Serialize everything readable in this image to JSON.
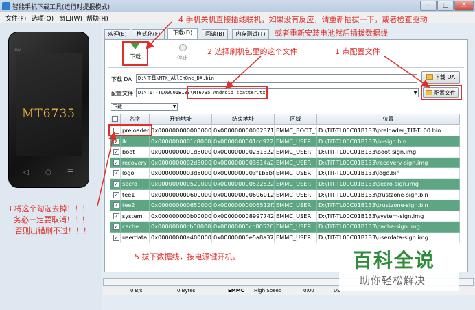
{
  "window": {
    "title": "智能手机下载工具(运行时提报模式)"
  },
  "winbuttons": {
    "min": "–",
    "max": "□",
    "close": "X"
  },
  "menu": [
    {
      "label": "文件(F)"
    },
    {
      "label": "选项(O)"
    },
    {
      "label": "窗口(W)"
    },
    {
      "label": "帮助(H)"
    }
  ],
  "phone": {
    "model": "MT6735",
    "brand": "IBM"
  },
  "tabs": [
    {
      "label": "欢迎(E)"
    },
    {
      "label": "格式化(F)"
    },
    {
      "label": "下载(D)"
    },
    {
      "label": "回读(B)"
    },
    {
      "label": "内存测试(T)"
    }
  ],
  "toolbar": {
    "download_label": "下载",
    "stop_label": "停止"
  },
  "fields": {
    "da_label": "下载 DA",
    "da_value": "D:\\工具\\MTK_AllInOne_DA.bin",
    "da_button": "下载 DA",
    "scatter_label": "配置文件",
    "scatter_value": "D:\\TIT-TL00C01B133\\MT6735_Android_scatter.txt",
    "scatter_button": "配置文件",
    "mode_value": "下载"
  },
  "table": {
    "headers": [
      "名字",
      "开始地址",
      "结束地址",
      "区域",
      "位置"
    ],
    "rows": [
      {
        "checked": false,
        "selected": false,
        "name": "preloader",
        "start": "0x0000000000000000",
        "end": "0x000000000002371f",
        "region": "EMMC_BOOT_1",
        "path": "D:\\TIT-TL00C01B133\\preloader_TIT-TL00.bin"
      },
      {
        "checked": true,
        "selected": true,
        "name": "lk",
        "start": "0x0000000001c80000",
        "end": "0x0000000001cd922b",
        "region": "EMMC_USER",
        "path": "D:\\TIT-TL00C01B133\\lk-sign.bin"
      },
      {
        "checked": true,
        "selected": false,
        "name": "boot",
        "start": "0x0000000001d80000",
        "end": "0x000000000251322b",
        "region": "EMMC_USER",
        "path": "D:\\TIT-TL00C01B133\\boot-sign.img"
      },
      {
        "checked": true,
        "selected": true,
        "name": "recovery",
        "start": "0x0000000002d80000",
        "end": "0x0000000003614a2b",
        "region": "EMMC_USER",
        "path": "D:\\TIT-TL00C01B133\\recovery-sign.img"
      },
      {
        "checked": true,
        "selected": false,
        "name": "logo",
        "start": "0x0000000003d80000",
        "end": "0x0000000003f1b3bf",
        "region": "EMMC_USER",
        "path": "D:\\TIT-TL00C01B133\\logo.bin"
      },
      {
        "checked": true,
        "selected": true,
        "name": "secro",
        "start": "0x0000000005200000",
        "end": "0x000000000522522b",
        "region": "EMMC_USER",
        "path": "D:\\TIT-TL00C01B133\\secro-sign.img"
      },
      {
        "checked": true,
        "selected": false,
        "name": "tee1",
        "start": "0x0000000006000000",
        "end": "0x000000000606012f2b",
        "region": "EMMC_USER",
        "path": "D:\\TIT-TL00C01B133\\trustzone-sign.bin"
      },
      {
        "checked": true,
        "selected": true,
        "name": "tee2",
        "start": "0x0000000006500000",
        "end": "0x00000000006512f2b",
        "region": "EMMC_USER",
        "path": "D:\\TIT-TL00C01B133\\trustzone-sign.bin"
      },
      {
        "checked": true,
        "selected": false,
        "name": "system",
        "start": "0x000000000b000000",
        "end": "0x0000000089977423",
        "region": "EMMC_USER",
        "path": "D:\\TIT-TL00C01B133\\system-sign.img"
      },
      {
        "checked": true,
        "selected": true,
        "name": "cache",
        "start": "0x00000000cb000000",
        "end": "0x00000000cb805267",
        "region": "EMMC_USER",
        "path": "D:\\TIT-TL00C01B133\\cache-sign.img"
      },
      {
        "checked": true,
        "selected": false,
        "name": "userdata",
        "start": "0x00000000e4000000",
        "end": "0x00000000e5a8a37b",
        "region": "EMMC_USER",
        "path": "D:\\TIT-TL00C01B133\\userdata-sign.img"
      }
    ]
  },
  "status": {
    "speed": "0 B/s",
    "bytes": "0 Bytes",
    "storage": "EMMC",
    "mode": "High Speed",
    "time": "0:00",
    "port": "US"
  },
  "annotations": {
    "a1": "1 点配置文件",
    "a2": "2 选择刷机包里的这个文件",
    "a3_line1": "3 将这个勾选去掉！！！",
    "a3_line2": "务必一定要取消！！！",
    "a3_line3": "否则出错刷不过！！！",
    "a4_line1": "4 手机关机直接插线联机，如果没有反应，请重新插拔一下，或者检查驱动",
    "a4_line2": "或者重新安装电池然后插拔数据线",
    "a5": "5 拔下数据线，按电源键开机。"
  },
  "watermark": {
    "brand": "百科全说",
    "slogan": "助你轻松解决"
  },
  "colors": {
    "accent_red": "#e0302a",
    "selected_row": "#5ea584",
    "watermark_green": "#2e8b3a"
  }
}
